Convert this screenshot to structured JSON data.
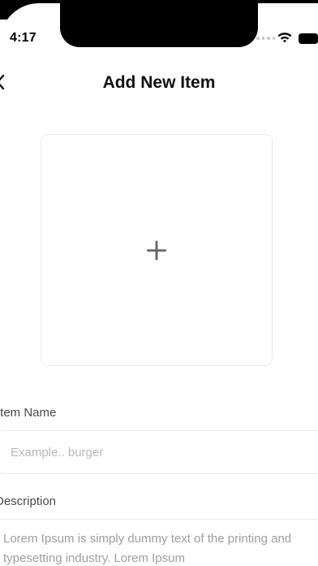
{
  "status_bar": {
    "time": "4:17"
  },
  "header": {
    "title": "Add New Item",
    "back_icon": "chevron-left-icon"
  },
  "image_picker": {
    "icon": "plus-icon"
  },
  "form": {
    "item_name": {
      "label": "Item Name",
      "placeholder": "Example.. burger"
    },
    "description": {
      "label": "Description",
      "value": "Lorem Ipsum is simply dummy text of the printing and typesetting industry. Lorem Ipsum"
    }
  }
}
